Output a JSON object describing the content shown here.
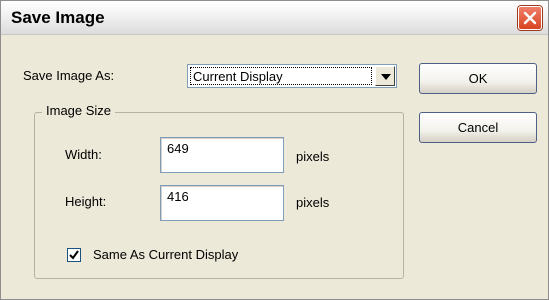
{
  "window": {
    "title": "Save Image",
    "close_icon": "close-x-icon"
  },
  "form": {
    "save_as_label": "Save Image As:",
    "save_as_value": "Current Display",
    "dropdown_icon": "chevron-down-icon",
    "group_label": "Image Size",
    "width_label": "Width:",
    "width_value": "649",
    "width_unit": "pixels",
    "height_label": "Height:",
    "height_value": "416",
    "height_unit": "pixels",
    "same_display_label": "Same As Current Display",
    "same_display_checked": true
  },
  "buttons": {
    "ok": "OK",
    "cancel": "Cancel"
  },
  "colors": {
    "dialog_background": "#ece9d8",
    "title_background": "#f0f0f0",
    "close_button": "#d8451f",
    "input_border": "#7f9db9",
    "button_border": "#4f5f86"
  }
}
